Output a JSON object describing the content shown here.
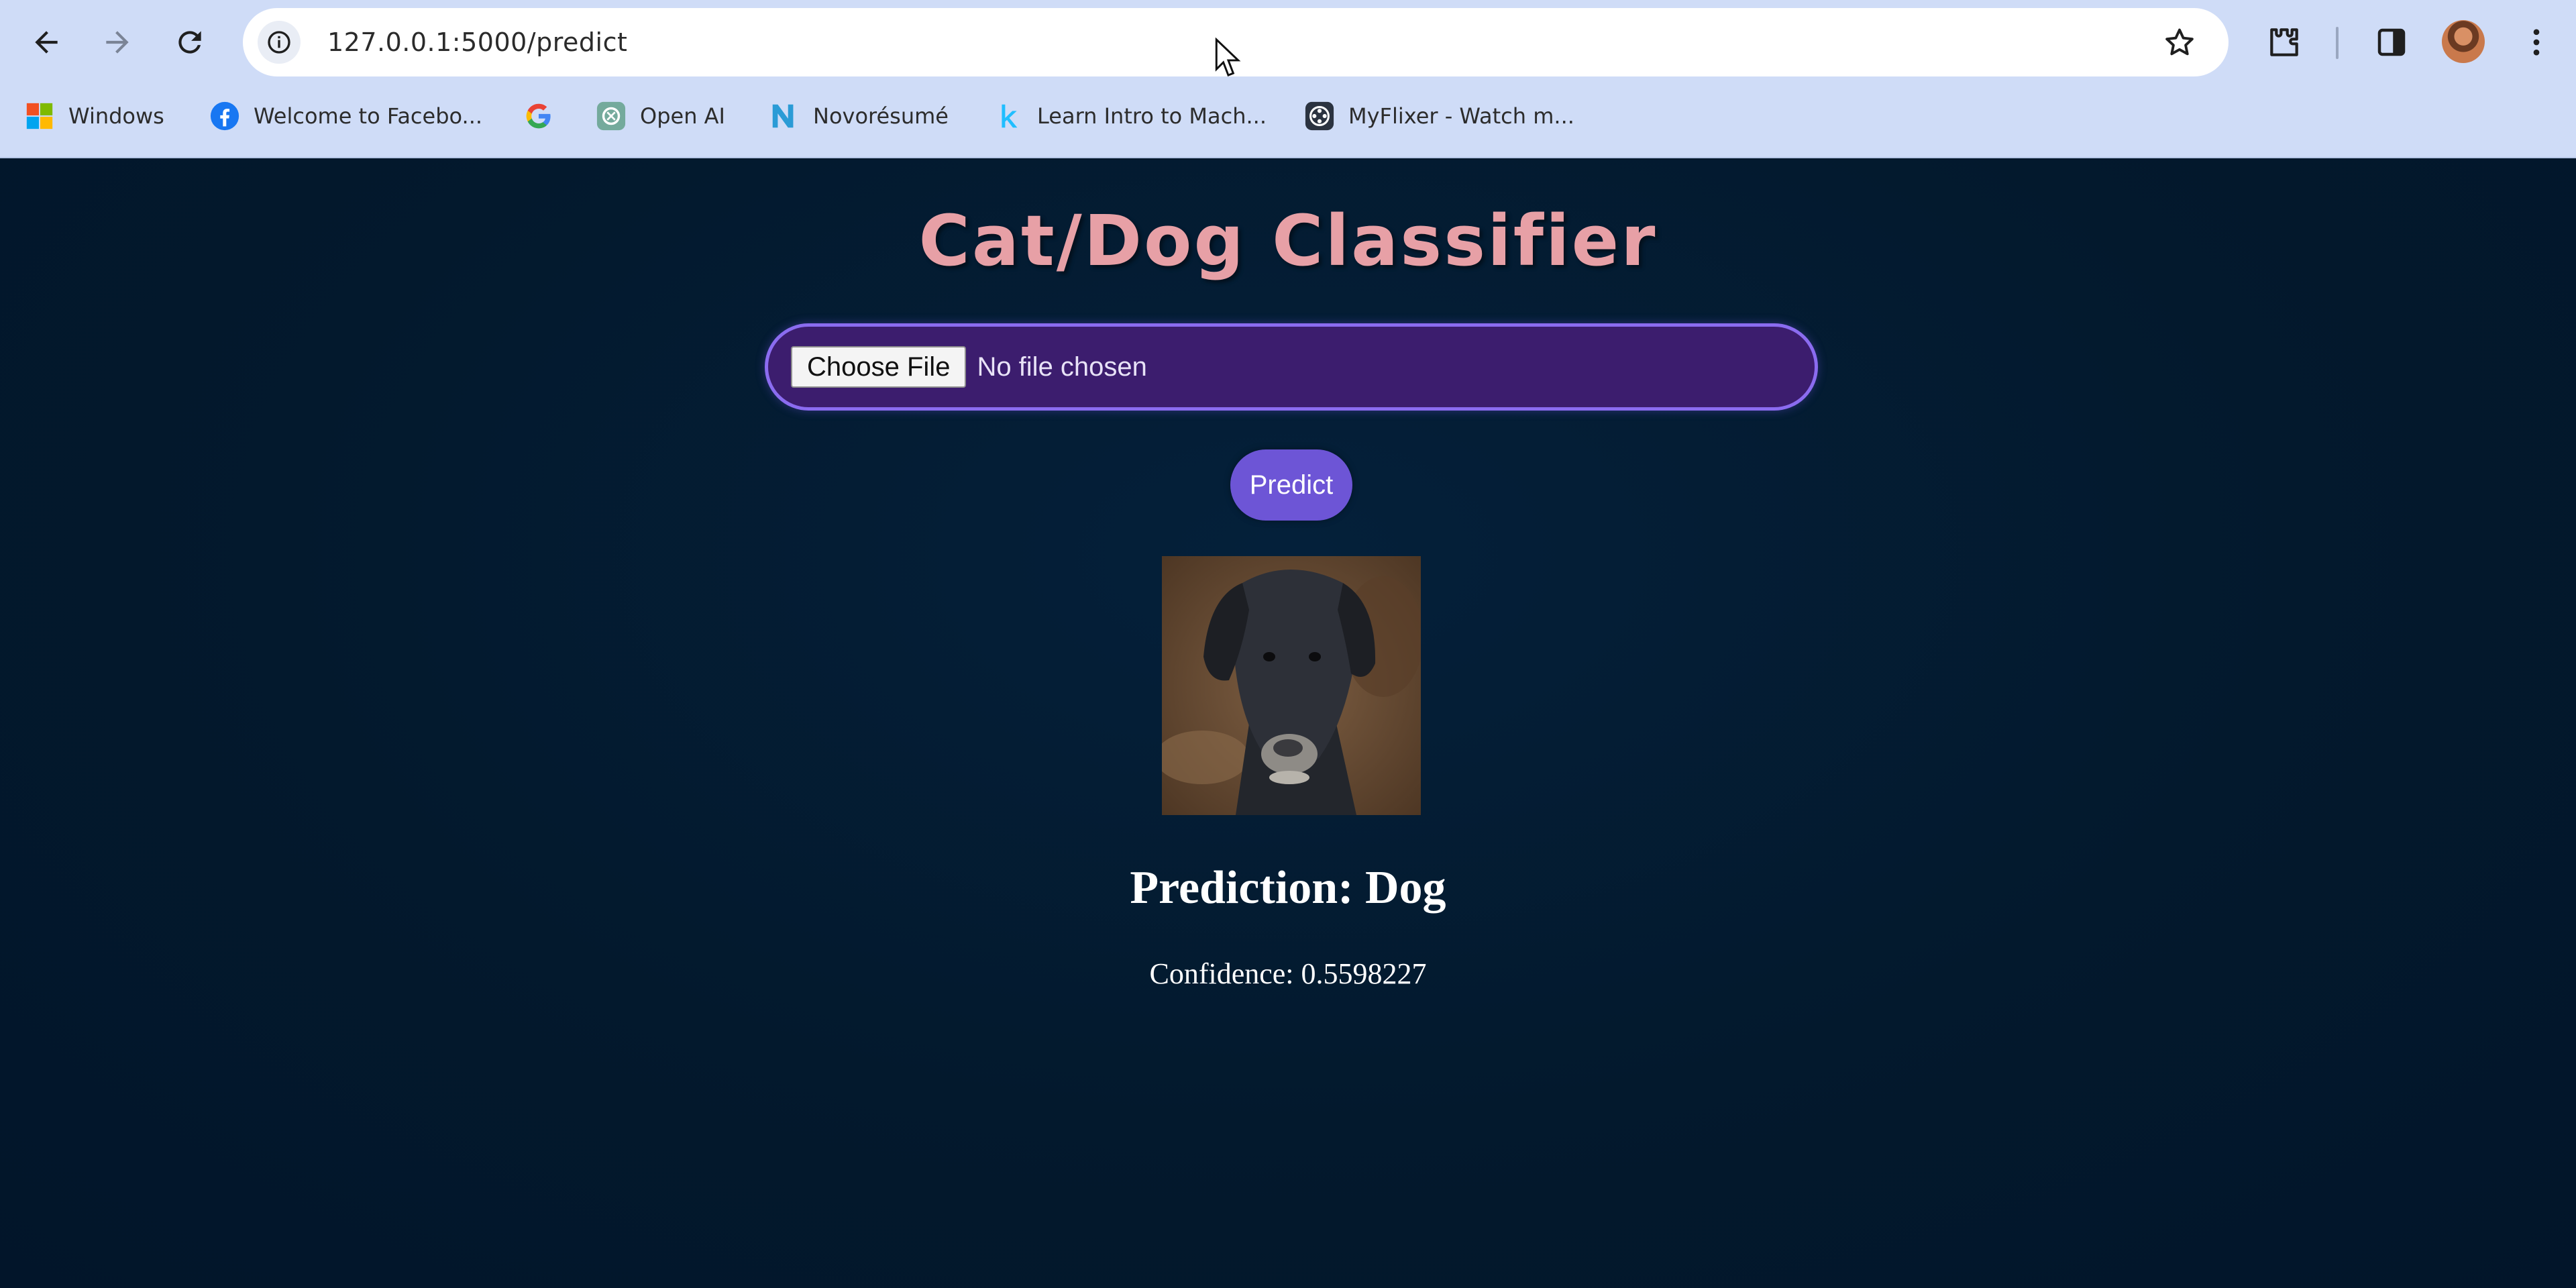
{
  "browser": {
    "url": "127.0.0.1:5000/predict",
    "bookmarks": [
      {
        "label": "Windows",
        "icon": "windows-icon"
      },
      {
        "label": "Welcome to Facebo...",
        "icon": "facebook-icon"
      },
      {
        "label": "",
        "icon": "google-icon"
      },
      {
        "label": "Open AI",
        "icon": "openai-icon"
      },
      {
        "label": "Novorésumé",
        "icon": "novoresume-icon"
      },
      {
        "label": "Learn Intro to Mach...",
        "icon": "kaggle-icon"
      },
      {
        "label": "MyFlixer - Watch m...",
        "icon": "myflixer-icon"
      }
    ]
  },
  "page": {
    "title": "Cat/Dog Classifier",
    "file_input": {
      "button_label": "Choose File",
      "status": "No file chosen"
    },
    "predict_label": "Predict",
    "prediction": "Prediction: Dog",
    "confidence": "Confidence: 0.5598227"
  },
  "colors": {
    "page_background": "#03182b",
    "title": "#e7a0a6",
    "file_input_background": "#3c1d6e",
    "file_input_border": "#8b6cf0",
    "predict_button": "#6d55d6",
    "browser_chrome": "#cfdcf7"
  }
}
